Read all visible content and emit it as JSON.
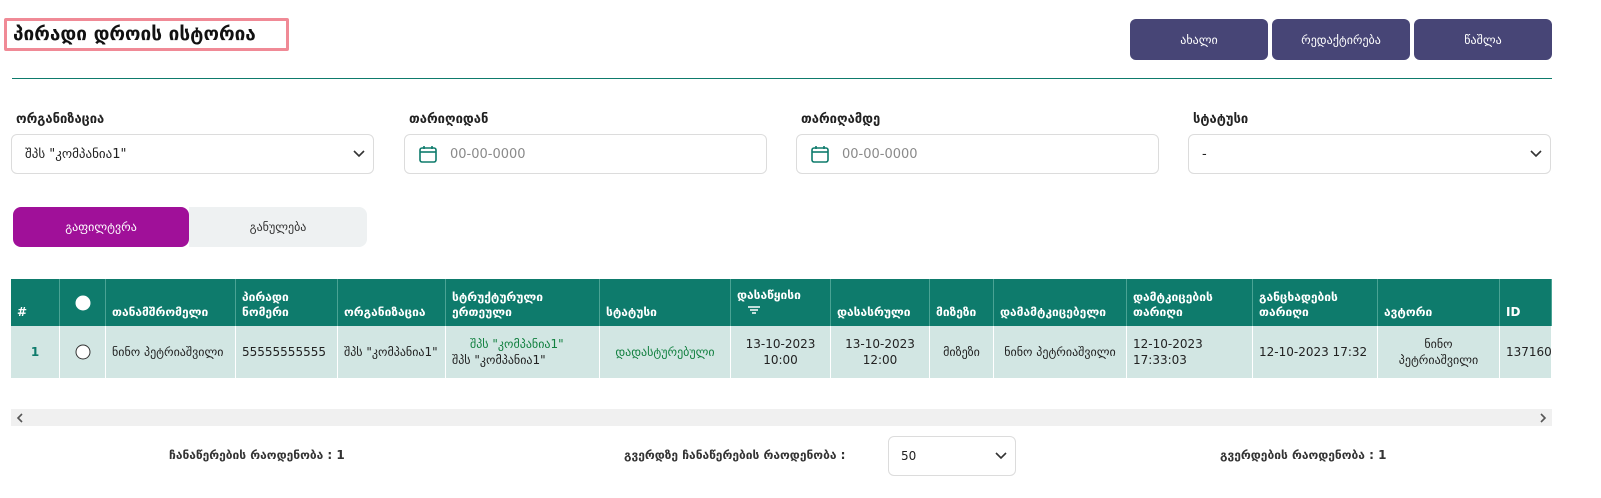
{
  "page": {
    "title": "პირადი დროის ისტორია"
  },
  "toolbar": {
    "new_label": "ახალი",
    "edit_label": "რედაქტირება",
    "delete_label": "წაშლა"
  },
  "filters": {
    "organization": {
      "label": "ორგანიზაცია",
      "value": "შპს \"კომპანია1\""
    },
    "date_from": {
      "label": "თარიღიდან",
      "placeholder": "00-00-0000"
    },
    "date_to": {
      "label": "თარიღამდე",
      "placeholder": "00-00-0000"
    },
    "status": {
      "label": "სტატუსი",
      "value": "-"
    },
    "filter_button": "გაფილტვრა",
    "reset_button": "განულება"
  },
  "table": {
    "headers": {
      "num": "#",
      "employee": "თანამშრომელი",
      "personal_number": "პირადი ნომერი",
      "organization": "ორგანიზაცია",
      "structural_unit": "სტრუქტურული ერთეული",
      "status": "სტატუსი",
      "start": "დასაწყისი",
      "end": "დასასრული",
      "reason": "მიზეზი",
      "approver": "დამამტკიცებელი",
      "approval_date": "დამტკიცების თარიღი",
      "application_date": "განცხადების თარიღი",
      "author": "ავტორი",
      "id": "ID"
    },
    "rows": [
      {
        "num": "1",
        "employee": "ნინო პეტრიაშვილი",
        "personal_number": "55555555555",
        "organization": "შპს \"კომპანია1\"",
        "structural_unit_line1": "შპს \"კომპანია1\"",
        "structural_unit_line2": "შპს \"კომპანია1\"",
        "status": "დადასტურებული",
        "start_date": "13-10-2023",
        "start_time": "10:00",
        "end_date": "13-10-2023",
        "end_time": "12:00",
        "reason": "მიზეზი",
        "approver": "ნინო პეტრიაშვილი",
        "approval_date": "12-10-2023 17:33:03",
        "application_date": "12-10-2023 17:32",
        "author": "ნინო პეტრიაშვილი",
        "id": "137160"
      }
    ]
  },
  "footer": {
    "records_count": "ჩანაწერების რაოდენობა : 1",
    "records_per_page_label": "გვერდზე ჩანაწერების რაოდენობა :",
    "records_per_page_value": "50",
    "pages_count": "გვერდების რაოდენობა : 1"
  },
  "colors": {
    "primary": "#474576",
    "accent": "#a01099",
    "table_header": "#0e7b6c",
    "row_bg": "#d2e6e3",
    "status_ok": "#128040"
  }
}
